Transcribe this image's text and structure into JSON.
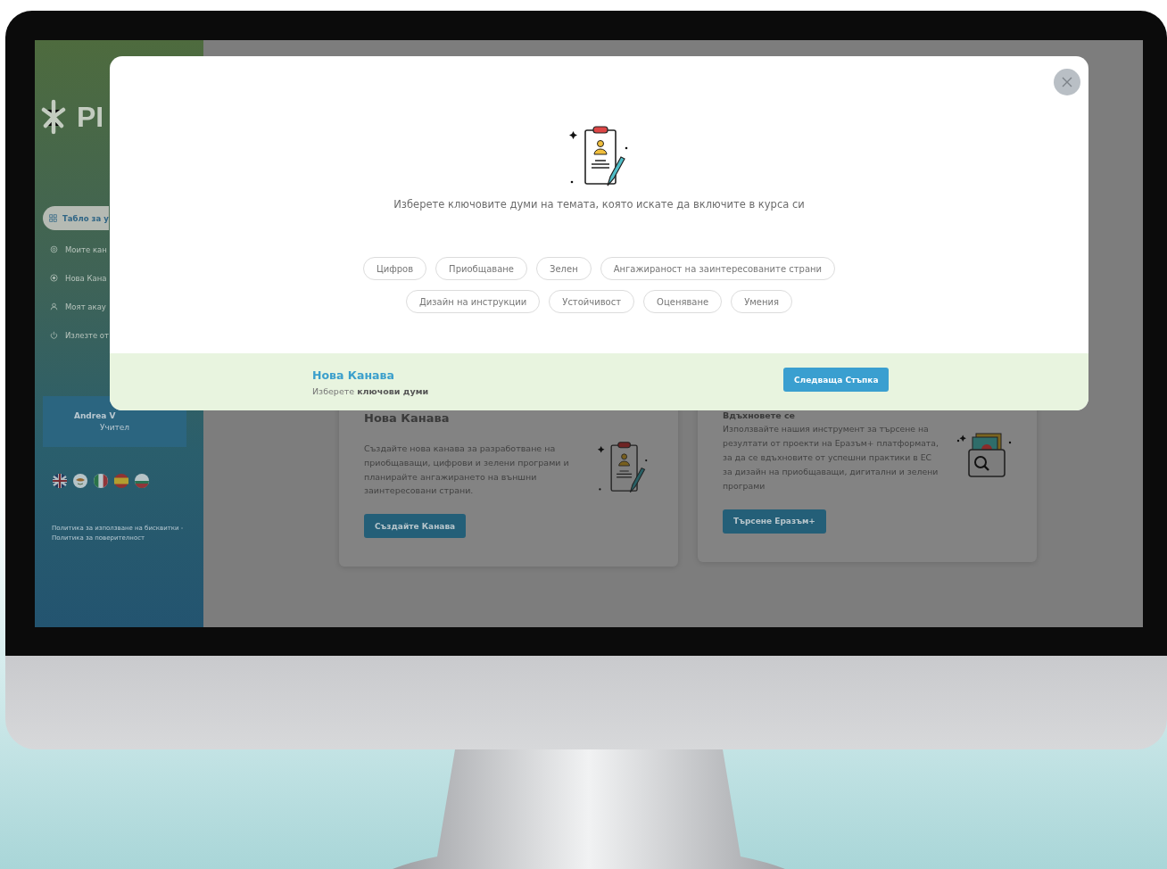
{
  "sidebar": {
    "logo_text": "PI",
    "nav_items": [
      {
        "label": "Табло за у",
        "selected": true
      },
      {
        "label": "Моите кан",
        "selected": false
      },
      {
        "label": "Нова Кана",
        "selected": false
      },
      {
        "label": "Моят акау",
        "selected": false
      },
      {
        "label": "Излезте от",
        "selected": false
      }
    ],
    "user": {
      "name": "Andrea V",
      "role": "Учител"
    },
    "footer_links": [
      "Политика за използване на бисквитки",
      "Политика за поверителност"
    ],
    "link_separator": "-"
  },
  "cards": [
    {
      "kind": "create",
      "title": "Нова Канава",
      "text": "Създайте нова канава за разработване на приобщаващи, цифрови и зелени програми и планирайте ангажирането на външни заинтересовани страни.",
      "button": "Създайте Канава"
    },
    {
      "kind": "inspire",
      "title": "Вдъхновете се",
      "text": "Използвайте нашия инструмент за търсене на резултати от проекти на Еразъм+ платформата, за да се вдъхновите от успешни практики в ЕС за дизайн на приобщаващи, дигитални и зелени програми",
      "button": "Търсене Еразъм+"
    }
  ],
  "modal": {
    "prompt": "Изберете ключовите думи на темата, която искате да включите в курса си",
    "keywords": [
      {
        "label": "Цифров",
        "selected": false
      },
      {
        "label": "Приобщаване",
        "selected": false
      },
      {
        "label": "Зелен",
        "selected": false
      },
      {
        "label": "Ангажираност на заинтересованите страни",
        "selected": false
      },
      {
        "label": "Дизайн на инструкции",
        "selected": false
      },
      {
        "label": "Устойчивост",
        "selected": false
      },
      {
        "label": "Оценяване",
        "selected": false
      },
      {
        "label": "Умения",
        "selected": false
      }
    ],
    "footer": {
      "title": "Нова Канава",
      "subtitle": "Изберете **ключови думи**"
    },
    "next_button": "Следваща Стъпка"
  }
}
